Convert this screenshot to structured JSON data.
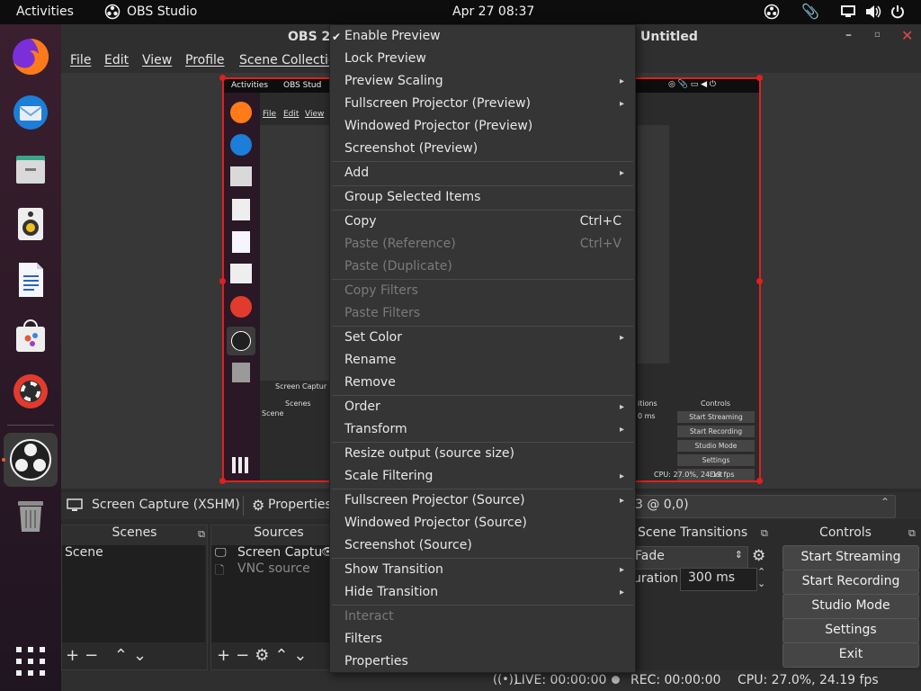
{
  "topbar": {
    "activities": "Activities",
    "app": "OBS Studio",
    "datetime": "Apr 27  08:37"
  },
  "window": {
    "title_left": "OBS 2",
    "title_right": "Untitled"
  },
  "menubar": [
    "File",
    "Edit",
    "View",
    "Profile",
    "Scene Collectio"
  ],
  "source_bar": {
    "source_name": "Screen Capture (XSHM)",
    "properties": "Properties",
    "transform": "3 @ 0,0)"
  },
  "scenes": {
    "title": "Scenes",
    "items": [
      "Scene"
    ]
  },
  "sources": {
    "title": "Sources",
    "items": [
      "Screen Captu",
      "VNC source"
    ]
  },
  "transitions": {
    "title": "Scene Transitions",
    "type": "Fade",
    "duration_label": "uration",
    "duration": "300 ms"
  },
  "controls": {
    "title": "Controls",
    "buttons": [
      "Start Streaming",
      "Start Recording",
      "Studio Mode",
      "Settings",
      "Exit"
    ]
  },
  "status": {
    "live": "LIVE: 00:00:00",
    "rec": "REC: 00:00:00",
    "cpu": "CPU: 27.0%, 24.19 fps"
  },
  "nested_preview": {
    "activities": "Activities",
    "app": "OBS Stud",
    "menus": [
      "File",
      "Edit",
      "View"
    ],
    "screen_capture": "Screen Captur",
    "scenes": "Scenes",
    "scene": "Scene",
    "controls": "Controls",
    "buttons": [
      "Start Streaming",
      "Start Recording",
      "Studio Mode",
      "Settings",
      "Exit"
    ],
    "transitions": "itions",
    "ms": "0 ms",
    "cpu": "CPU: 27.0%, 24.19 fps"
  },
  "context_menu": {
    "items": [
      {
        "label": "Enable Preview",
        "checked": true
      },
      {
        "label": "Lock Preview"
      },
      {
        "label": "Preview Scaling",
        "submenu": true
      },
      {
        "label": "Fullscreen Projector (Preview)",
        "submenu": true
      },
      {
        "label": "Windowed Projector (Preview)"
      },
      {
        "label": "Screenshot (Preview)"
      },
      {
        "label": "Add",
        "submenu": true
      },
      {
        "label": "Group Selected Items"
      },
      {
        "label": "Copy",
        "shortcut": "Ctrl+C"
      },
      {
        "label": "Paste (Reference)",
        "shortcut": "Ctrl+V",
        "disabled": true
      },
      {
        "label": "Paste (Duplicate)",
        "disabled": true
      },
      {
        "label": "Copy Filters",
        "disabled": true
      },
      {
        "label": "Paste Filters",
        "disabled": true
      },
      {
        "label": "Set Color",
        "submenu": true
      },
      {
        "label": "Rename"
      },
      {
        "label": "Remove"
      },
      {
        "label": "Order",
        "submenu": true
      },
      {
        "label": "Transform",
        "submenu": true
      },
      {
        "label": "Resize output (source size)"
      },
      {
        "label": "Scale Filtering",
        "submenu": true
      },
      {
        "label": "Fullscreen Projector (Source)",
        "submenu": true
      },
      {
        "label": "Windowed Projector (Source)"
      },
      {
        "label": "Screenshot (Source)"
      },
      {
        "label": "Show Transition",
        "submenu": true
      },
      {
        "label": "Hide Transition",
        "submenu": true
      },
      {
        "label": "Interact",
        "disabled": true
      },
      {
        "label": "Filters"
      },
      {
        "label": "Properties"
      }
    ]
  }
}
